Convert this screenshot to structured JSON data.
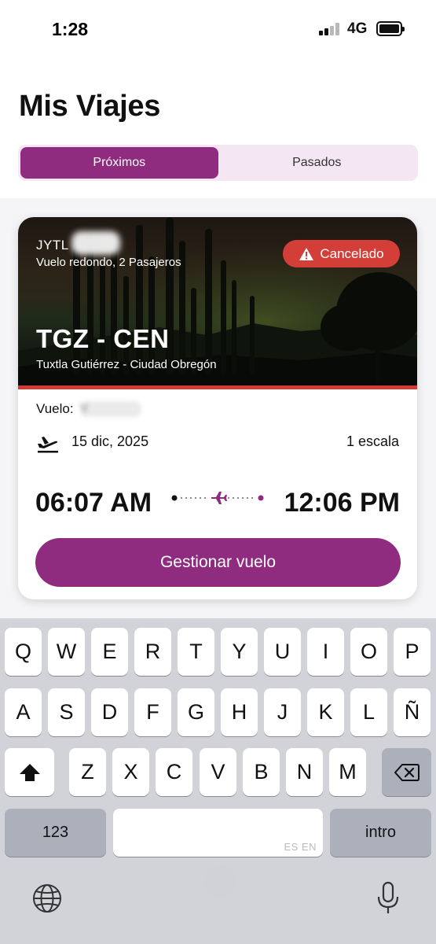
{
  "status_bar": {
    "time": "1:28",
    "network": "4G"
  },
  "page": {
    "title": "Mis Viajes"
  },
  "tabs": [
    {
      "label": "Próximos",
      "active": true
    },
    {
      "label": "Pasados",
      "active": false
    }
  ],
  "trip": {
    "booking_code": "JYTL",
    "trip_type": "Vuelo redondo, 2 Pasajeros",
    "status": "Cancelado",
    "route": "TGZ - CEN",
    "cities": "Tuxtla Gutiérrez - Ciudad Obregón",
    "flight_label": "Vuelo:",
    "flight_number_partial": "Y",
    "date": "15 dic, 2025",
    "stops": "1 escala",
    "departure_time": "06:07 AM",
    "arrival_time": "12:06 PM",
    "manage_button": "Gestionar vuelo"
  },
  "keyboard": {
    "row1": [
      "Q",
      "W",
      "E",
      "R",
      "T",
      "Y",
      "U",
      "I",
      "O",
      "P"
    ],
    "row2": [
      "A",
      "S",
      "D",
      "F",
      "G",
      "H",
      "J",
      "K",
      "L",
      "Ñ"
    ],
    "row3": [
      "Z",
      "X",
      "C",
      "V",
      "B",
      "N",
      "M"
    ],
    "numbers_key": "123",
    "space_hint": "ES EN",
    "return_key": "intro"
  },
  "colors": {
    "brand": "#8f2c80",
    "brand_light": "#f4e6f2",
    "cancel_red": "#d33e38",
    "keyboard_bg": "#d1d3d9"
  }
}
